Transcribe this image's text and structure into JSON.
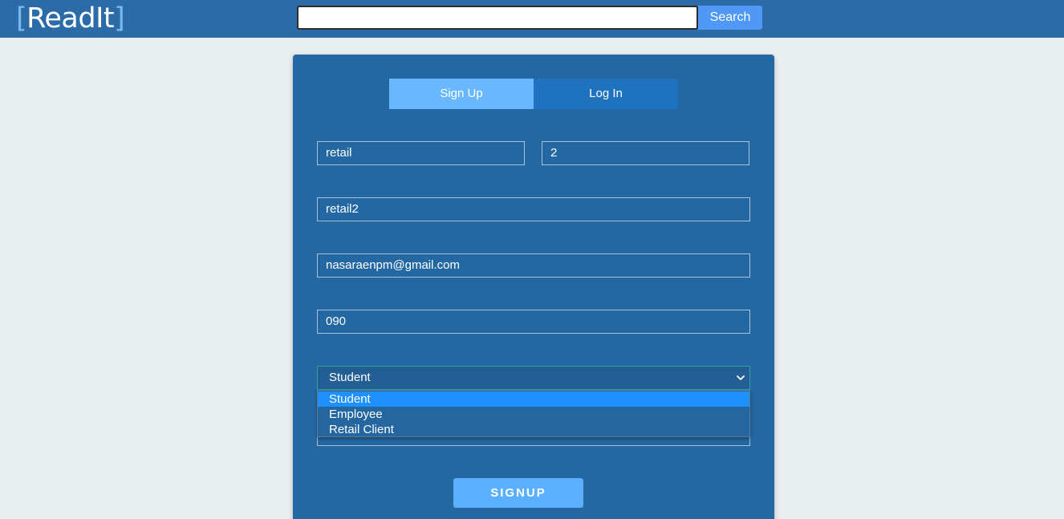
{
  "header": {
    "logo_open_bracket": "[",
    "logo_text": "ReadIt",
    "logo_close_bracket": "]",
    "search_value": "",
    "search_button_label": "Search"
  },
  "tabs": [
    {
      "label": "Sign Up",
      "active": true
    },
    {
      "label": "Log In",
      "active": false
    }
  ],
  "form": {
    "first_name_value": "retail",
    "last_name_value": "2",
    "username_value": "retail2",
    "email_value": "nasaraenpm@gmail.com",
    "phone_value": "090",
    "user_type": {
      "selected": "Student",
      "expanded": true,
      "options": [
        "Student",
        "Employee",
        "Retail Client"
      ]
    },
    "submit_label": "SIGNUP"
  },
  "colors": {
    "navbar": "#2a6ba8",
    "card": "#2368a2",
    "tab_active": "#69b8ff",
    "tab_inactive": "#1f72bd",
    "accent": "#5ab0ff",
    "option_highlight": "#1e90ff"
  },
  "icons": {
    "select_arrow": "chevron-down-icon"
  }
}
